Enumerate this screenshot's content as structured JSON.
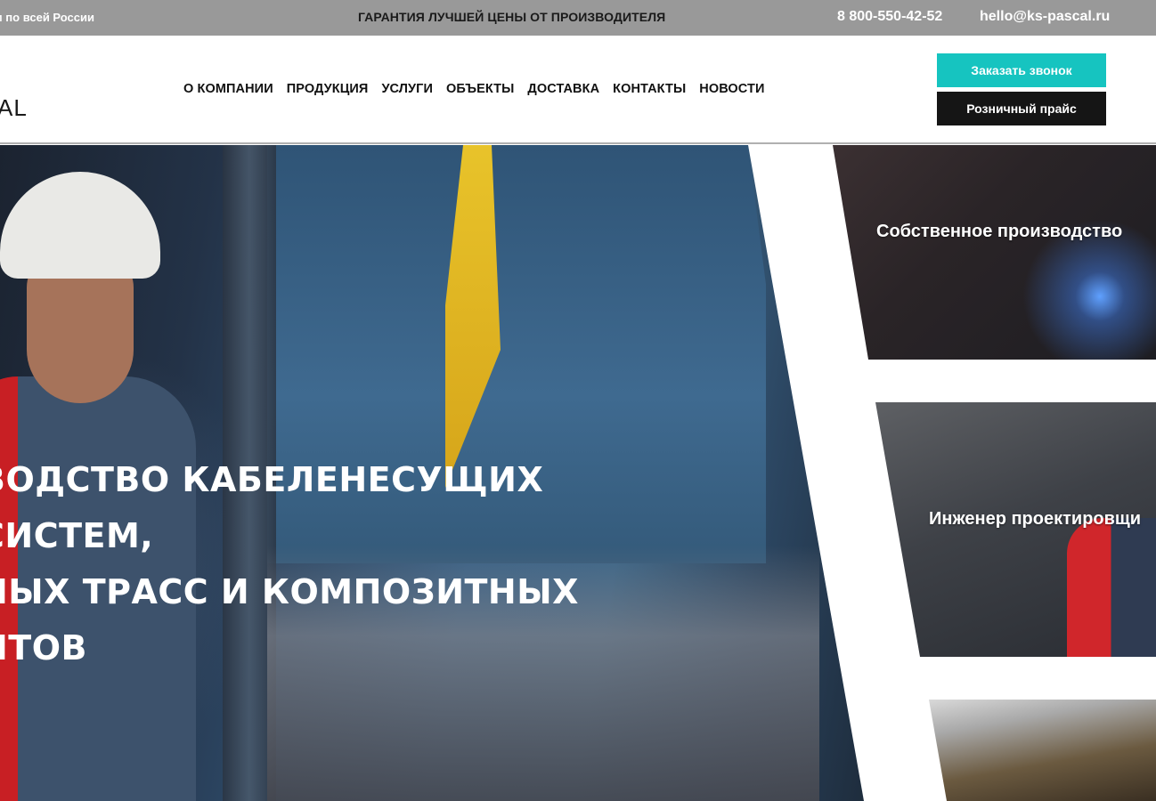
{
  "topbar": {
    "left_text": "ем по всей России",
    "center_text": "ГАРАНТИЯ ЛУЧШЕЙ ЦЕНЫ ОТ ПРОИЗВОДИТЕЛЯ",
    "phone": "8 800-550-42-52",
    "email": "hello@ks-pascal.ru"
  },
  "header": {
    "logo_text": "AL",
    "nav": [
      "О КОМПАНИИ",
      "ПРОДУКЦИЯ",
      "УСЛУГИ",
      "ОБЪЕКТЫ",
      "ДОСТАВКА",
      "КОНТАКТЫ",
      "НОВОСТИ"
    ],
    "call_button": "Заказать звонок",
    "price_button": "Розничный прайс"
  },
  "hero": {
    "title": "ВОДСТВО КАБЕЛЕНЕСУЩИХ СИСТЕМ,\nНЫХ ТРАСС И КОМПОЗИТНЫХ\nНТОВ"
  },
  "tiles": [
    {
      "label": "Собственное производство"
    },
    {
      "label": "Инженер проектировщи"
    },
    {
      "label": ""
    }
  ],
  "colors": {
    "accent": "#16c4c0",
    "topbar": "#999999",
    "dark_button": "#151515"
  }
}
